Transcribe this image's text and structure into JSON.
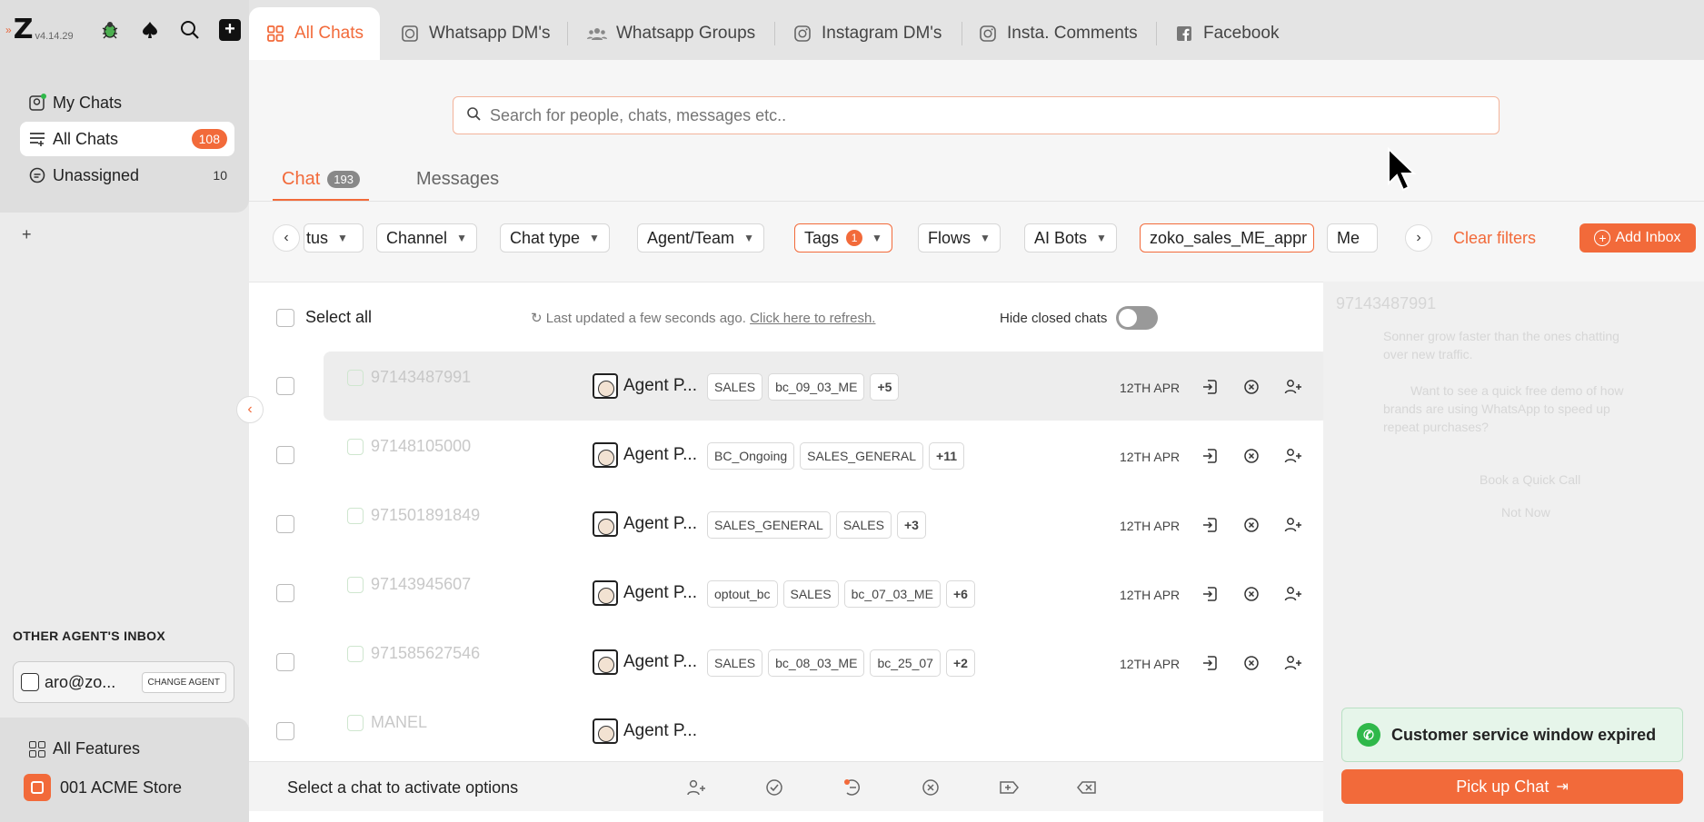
{
  "app": {
    "version": "v4.14.29"
  },
  "sidebar": {
    "items": [
      {
        "label": "My Chats"
      },
      {
        "label": "All Chats",
        "badge": "108"
      },
      {
        "label": "Unassigned",
        "count": "10"
      }
    ],
    "other_inbox_label": "OTHER AGENT'S INBOX",
    "agent_email": "aro@zo...",
    "change_agent_label": "CHANGE AGENT",
    "all_features_label": "All Features",
    "store_label": "001 ACME Store"
  },
  "tabs": [
    {
      "label": "All Chats",
      "icon": "grid-icon",
      "active": true
    },
    {
      "label": "Whatsapp DM's",
      "icon": "whatsapp-icon"
    },
    {
      "label": "Whatsapp Groups",
      "icon": "group-icon"
    },
    {
      "label": "Instagram DM's",
      "icon": "instagram-icon"
    },
    {
      "label": "Insta. Comments",
      "icon": "instagram-icon"
    },
    {
      "label": "Facebook",
      "icon": "facebook-icon"
    }
  ],
  "search": {
    "placeholder": "Search for people, chats, messages etc.."
  },
  "subtabs": {
    "chat_label": "Chat",
    "chat_count": "193",
    "messages_label": "Messages"
  },
  "filters": {
    "chips": [
      "tus",
      "Channel",
      "Chat type",
      "Agent/Team",
      "Tags",
      "Flows",
      "AI Bots",
      "zoko_sales_ME_appr",
      "Me"
    ],
    "tags_count": "1",
    "clear_label": "Clear filters",
    "add_inbox_label": "Add Inbox"
  },
  "list": {
    "select_all_label": "Select all",
    "updated_text": "Last updated a few seconds ago.",
    "refresh_link": "Click here to refresh.",
    "hide_closed_label": "Hide closed chats",
    "rows": [
      {
        "phone": "97143487991",
        "agent": "Agent P...",
        "tags": [
          "SALES",
          "bc_09_03_ME",
          "+5"
        ],
        "date": "12TH APR"
      },
      {
        "phone": "97148105000",
        "agent": "Agent P...",
        "tags": [
          "BC_Ongoing",
          "SALES_GENERAL",
          "+11"
        ],
        "date": "12TH APR"
      },
      {
        "phone": "971501891849",
        "agent": "Agent P...",
        "tags": [
          "SALES_GENERAL",
          "SALES",
          "+3"
        ],
        "date": "12TH APR"
      },
      {
        "phone": "97143945607",
        "agent": "Agent P...",
        "tags": [
          "optout_bc",
          "SALES",
          "bc_07_03_ME",
          "+6"
        ],
        "date": "12TH APR"
      },
      {
        "phone": "971585627546",
        "agent": "Agent P...",
        "tags": [
          "SALES",
          "bc_08_03_ME",
          "bc_25_07",
          "+2"
        ],
        "date": "12TH APR"
      },
      {
        "phone": "MANEL",
        "agent": "Agent P...",
        "tags": [],
        "date": ""
      }
    ],
    "bottom_text": "Select a chat to activate options"
  },
  "preview": {
    "faint_phone": "97143487991",
    "faint_lines": [
      "Sonner grow faster than the ones chatting",
      "over new traffic.",
      "Want to see a quick free demo of how",
      "brands are using WhatsApp to speed up",
      "repeat purchases?",
      "Book a Quick Call",
      "Not Now"
    ],
    "window_expired": "Customer service window expired",
    "pickup_label": "Pick up Chat"
  },
  "colors": {
    "accent": "#f26a3a",
    "whatsapp": "#2fb84a"
  }
}
